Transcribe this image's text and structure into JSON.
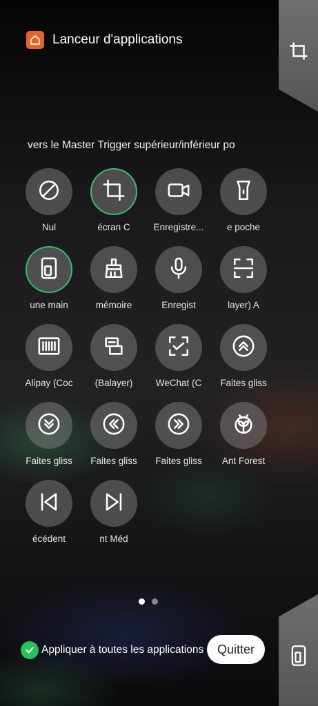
{
  "header": {
    "title": "Lanceur d'applications",
    "icon": "home-icon"
  },
  "side_tabs": {
    "top_icon": "crop-icon",
    "bottom_icon": "phone-icon"
  },
  "marquee": "vers le Master Trigger supérieur/inférieur po",
  "items": [
    {
      "label": "Nul",
      "icon": "no-symbol-icon",
      "selected": false
    },
    {
      "label": "écran    C",
      "icon": "crop-icon",
      "selected": true
    },
    {
      "label": "Enregistre...",
      "icon": "video-camera-icon",
      "selected": false
    },
    {
      "label": "e poche",
      "icon": "flashlight-icon",
      "selected": false
    },
    {
      "label": "une main",
      "icon": "one-hand-mode-icon",
      "selected": true
    },
    {
      "label": "mémoire",
      "icon": "broom-clean-icon",
      "selected": false
    },
    {
      "label": "Enregist",
      "icon": "microphone-icon",
      "selected": false
    },
    {
      "label": "layer)    A",
      "icon": "scan-icon",
      "selected": false
    },
    {
      "label": "Alipay (Coc",
      "icon": "barcode-icon",
      "selected": false
    },
    {
      "label": "(Balayer)",
      "icon": "card-scan-icon",
      "selected": false
    },
    {
      "label": "WeChat (C",
      "icon": "wechat-scan-icon",
      "selected": false
    },
    {
      "label": "Faites gliss",
      "icon": "double-chevron-up-icon",
      "selected": false
    },
    {
      "label": "Faites gliss",
      "icon": "double-chevron-down-icon",
      "selected": false
    },
    {
      "label": "Faites gliss",
      "icon": "double-chevron-left-icon",
      "selected": false
    },
    {
      "label": "Faites gliss",
      "icon": "double-chevron-right-icon",
      "selected": false
    },
    {
      "label": "Ant Forest",
      "icon": "sprout-icon",
      "selected": false
    },
    {
      "label": "écédent",
      "icon": "skip-previous-icon",
      "selected": false
    },
    {
      "label": "nt    Méd",
      "icon": "skip-next-icon",
      "selected": false
    }
  ],
  "pagination": {
    "pages": 2,
    "current": 1
  },
  "footer": {
    "apply_label": "Appliquer à toutes les applications",
    "apply_checked": true,
    "quit_label": "Quitter"
  },
  "colors": {
    "accent": "#2fbf71",
    "check": "#27c15d",
    "app_icon": "#e8642c"
  }
}
